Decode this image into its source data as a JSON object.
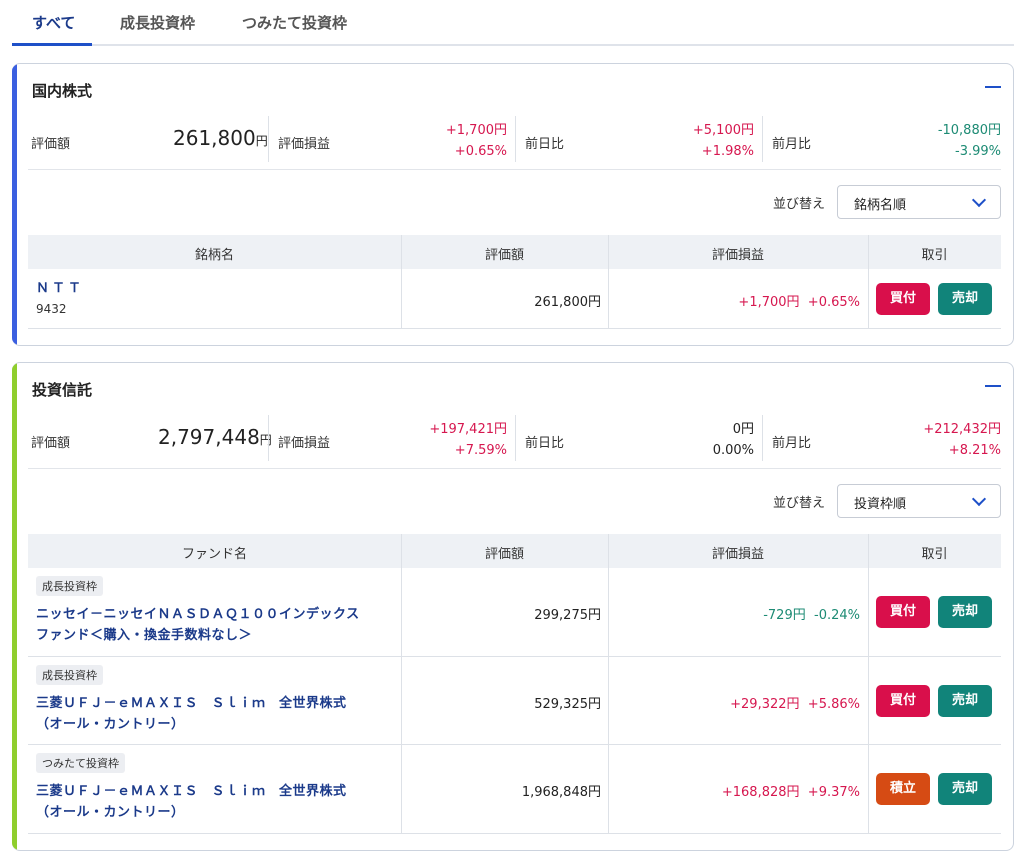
{
  "tabs": [
    {
      "label": "すべて",
      "active": true
    },
    {
      "label": "成長投資枠",
      "active": false
    },
    {
      "label": "つみたて投資枠",
      "active": false
    }
  ],
  "labels": {
    "valuation": "評価額",
    "pl": "評価損益",
    "day": "前日比",
    "month": "前月比",
    "sort": "並び替え",
    "col_amount": "評価額",
    "col_pl": "評価損益",
    "col_trade": "取引",
    "yen": "円",
    "buy": "買付",
    "sell": "売却",
    "accumulate": "積立"
  },
  "colors": {
    "domestic_accent": "#3b5fe0",
    "fund_accent": "#8fce2d",
    "positive": "#d6174f",
    "negative": "#1d8b74"
  },
  "domestic": {
    "title": "国内株式",
    "value": "261,800",
    "pl_amount": "+1,700円",
    "pl_pct": "+0.65%",
    "day_amount": "+5,100円",
    "day_pct": "+1.98%",
    "month_amount": "-10,880円",
    "month_pct": "-3.99%",
    "sort_value": "銘柄名順",
    "col_name": "銘柄名",
    "rows": [
      {
        "name": "ＮＴＴ",
        "code": "9432",
        "amount": "261,800円",
        "pl_amount": "+1,700円",
        "pl_pct": "+0.65%"
      }
    ]
  },
  "funds": {
    "title": "投資信託",
    "value": "2,797,448",
    "pl_amount": "+197,421円",
    "pl_pct": "+7.59%",
    "day_amount": "0円",
    "day_pct": "0.00%",
    "month_amount": "+212,432円",
    "month_pct": "+8.21%",
    "sort_value": "投資枠順",
    "col_name": "ファンド名",
    "rows": [
      {
        "badge": "成長投資枠",
        "line1": "ニッセイ－ニッセイＮＡＳＤＡＱ１００インデックス",
        "line2": "ファンド＜購入・換金手数料なし＞",
        "amount": "299,275円",
        "pl_amount": "-729円",
        "pl_pct": "-0.24%"
      },
      {
        "badge": "成長投資枠",
        "line1": "三菱ＵＦＪ－ｅＭＡＸＩＳ　Ｓｌｉｍ　全世界株式",
        "line2": "（オール・カントリー）",
        "amount": "529,325円",
        "pl_amount": "+29,322円",
        "pl_pct": "+5.86%"
      },
      {
        "badge": "つみたて投資枠",
        "line1": "三菱ＵＦＪ－ｅＭＡＸＩＳ　Ｓｌｉｍ　全世界株式",
        "line2": "（オール・カントリー）",
        "amount": "1,968,848円",
        "pl_amount": "+168,828円",
        "pl_pct": "+9.37%"
      }
    ]
  }
}
